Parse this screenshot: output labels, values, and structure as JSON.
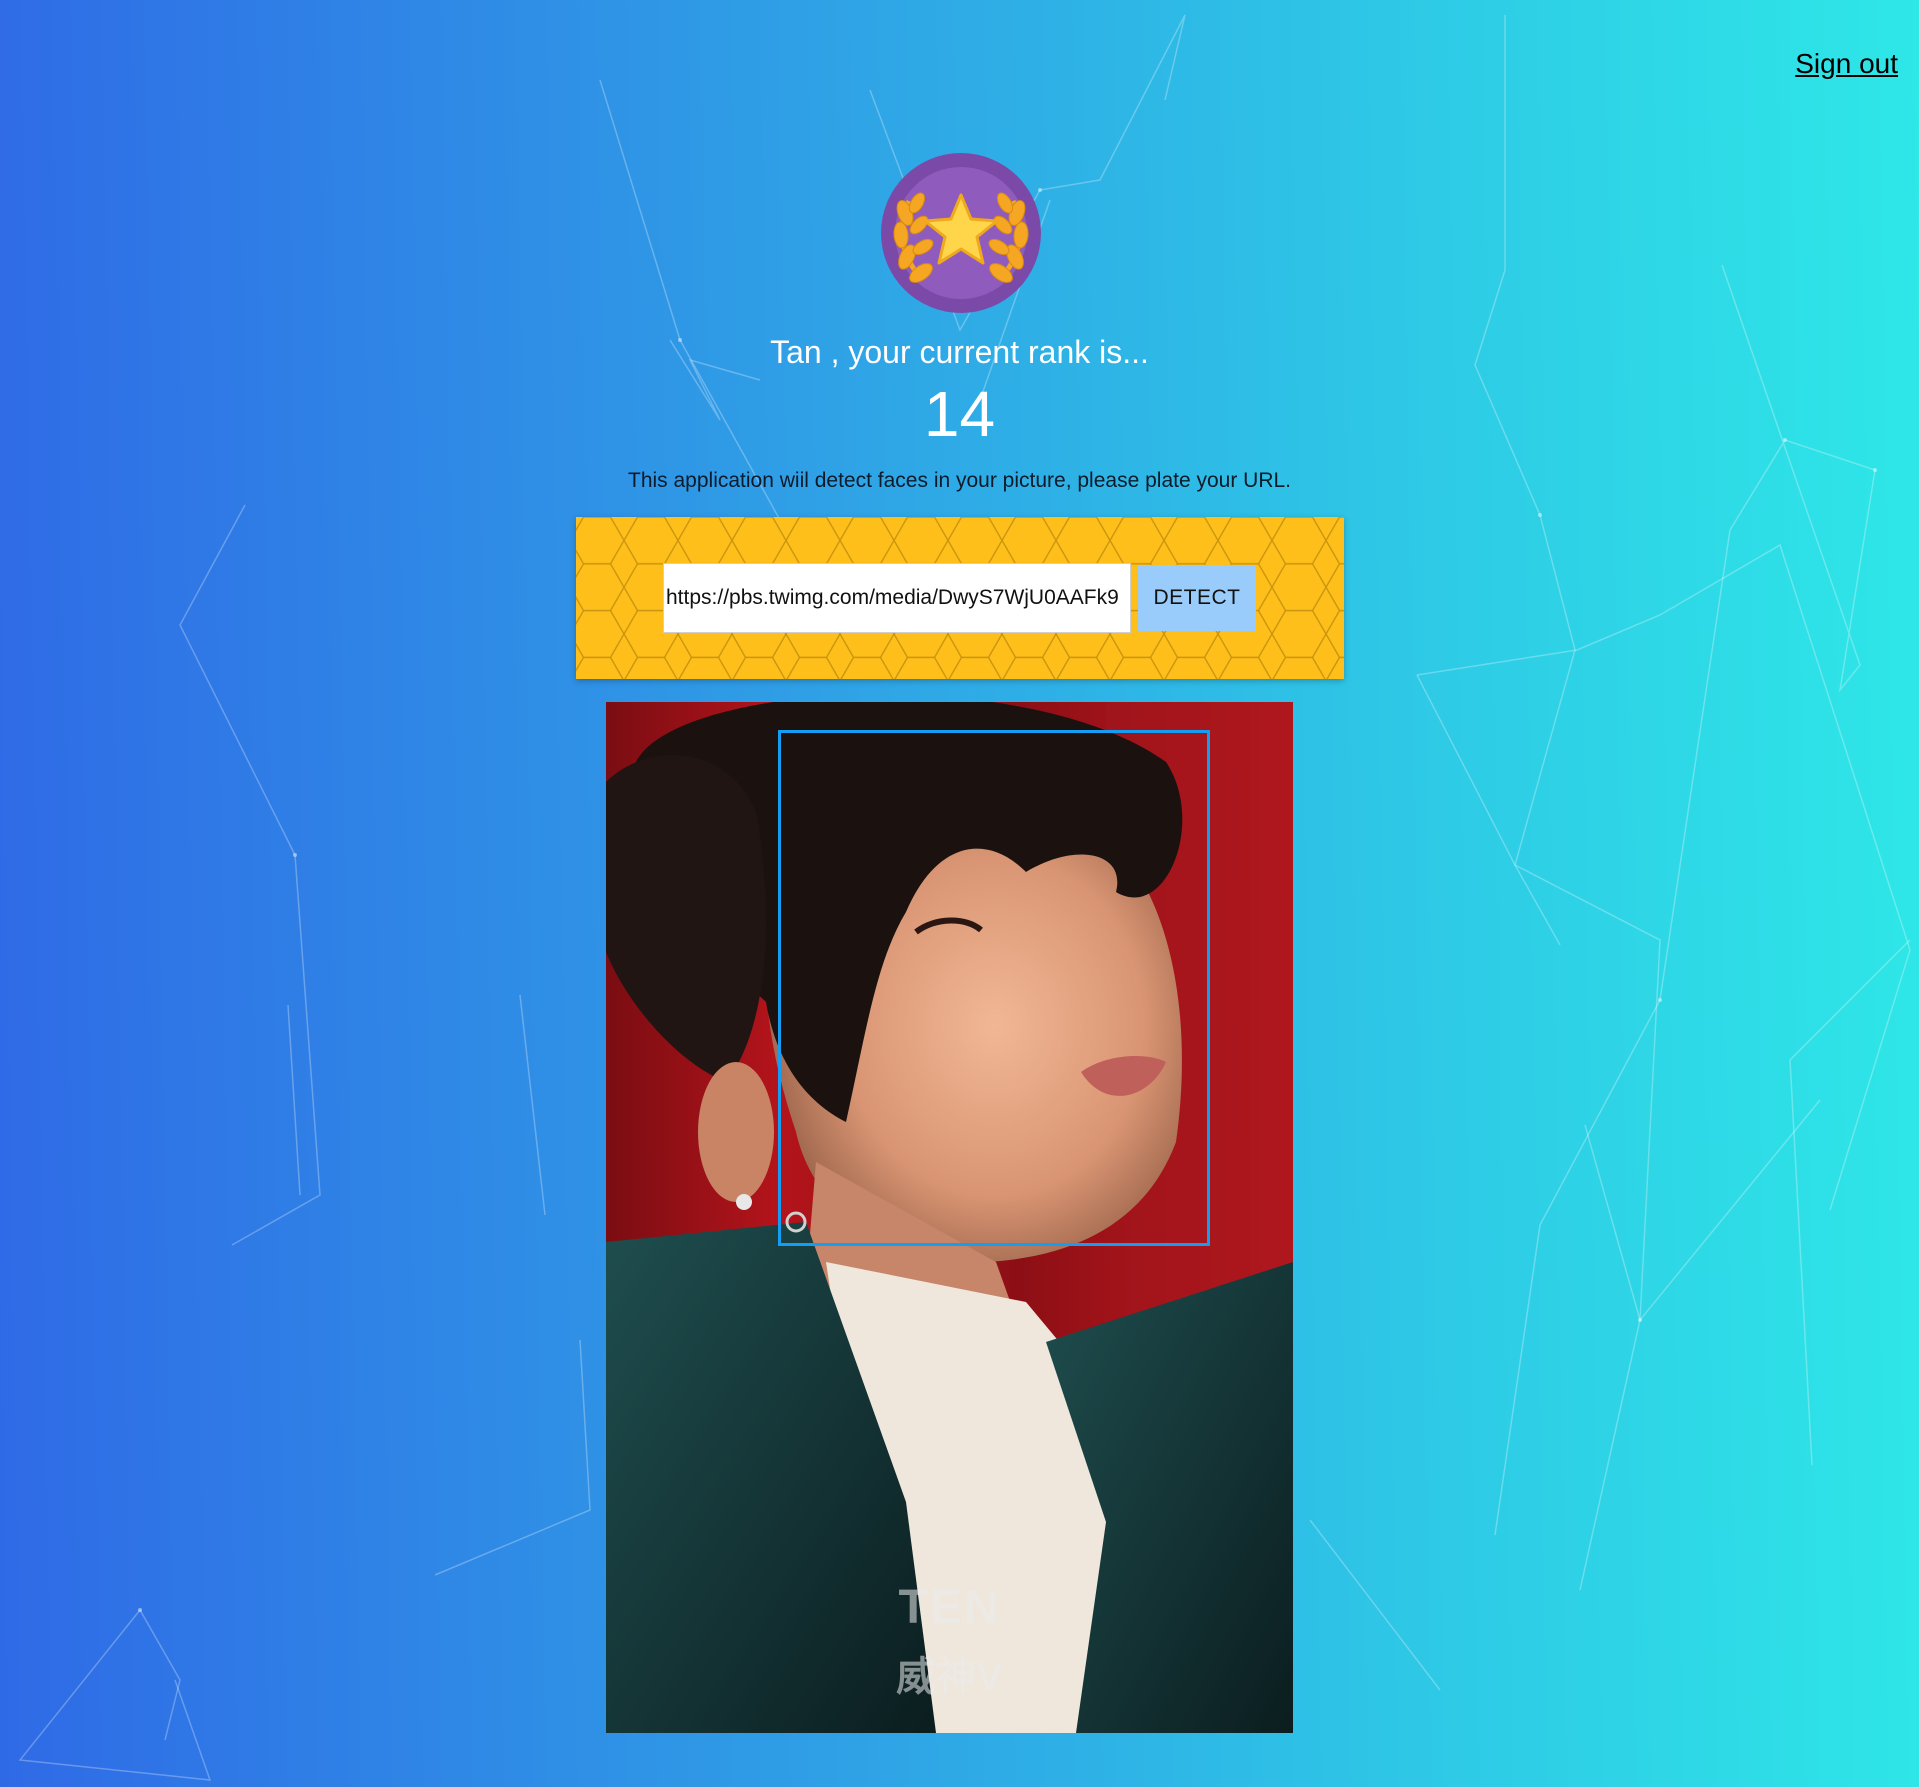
{
  "header": {
    "signout_label": "Sign out"
  },
  "logo": {
    "icon": "laurel-star-badge-icon",
    "colors": {
      "ring": "#7b4aa8",
      "inner": "#8d5bb8",
      "laurel": "#f5a623",
      "star": "#ffd54a"
    }
  },
  "greeting": {
    "name": "Tan",
    "text": "Tan , your current rank is..."
  },
  "rank": {
    "value": "14"
  },
  "instructions": {
    "text": "This application wiil detect faces in your picture, please plate your URL."
  },
  "form": {
    "url_value": "https://pbs.twimg.com/media/DwyS7WjU0AAFk9",
    "detect_label": "DETECT",
    "panel_color": "#ffbf1a",
    "button_color": "#99ccfb"
  },
  "photo": {
    "watermark_line1": "TEN",
    "watermark_line2": "威神V",
    "face_box_color": "#149df2"
  },
  "theme": {
    "gradient_start": "#2f6ae6",
    "gradient_end": "#2ee7e7"
  }
}
